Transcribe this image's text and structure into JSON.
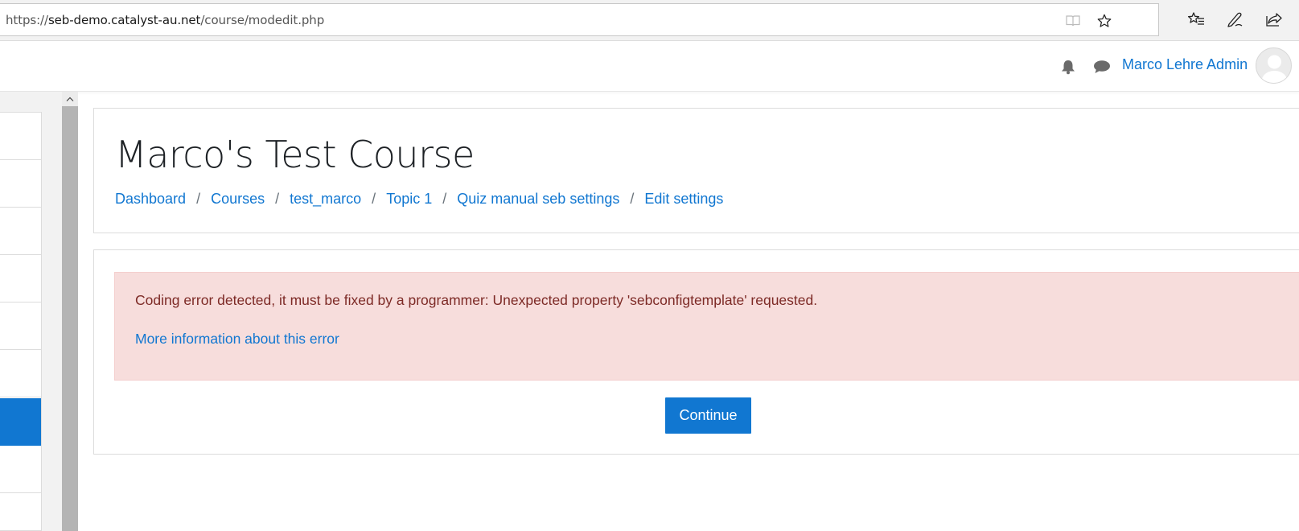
{
  "browser": {
    "url_prefix": "https://",
    "url_host": "seb-demo.catalyst-au.net",
    "url_path": "/course/modedit.php",
    "icons": [
      "reading-view-icon",
      "favorite-star-icon",
      "favorites-list-icon",
      "pen-icon",
      "share-icon"
    ]
  },
  "navbar": {
    "user_name": "Marco Lehre Admin",
    "icons": [
      "bell-icon",
      "chat-icon",
      "avatar"
    ]
  },
  "header": {
    "title": "Marco's Test Course",
    "breadcrumbs": [
      "Dashboard",
      "Courses",
      "test_marco",
      "Topic 1",
      "Quiz manual seb settings",
      "Edit settings"
    ],
    "separator": "/"
  },
  "error": {
    "message": "Coding error detected, it must be fixed by a programmer: Unexpected property 'sebconfigtemplate' requested.",
    "more_info_link": "More information about this error",
    "continue_label": "Continue"
  },
  "colors": {
    "link": "#1177d1",
    "alert_bg": "#f7dddc",
    "alert_text": "#7d2a26",
    "primary_button": "#1177d1"
  }
}
